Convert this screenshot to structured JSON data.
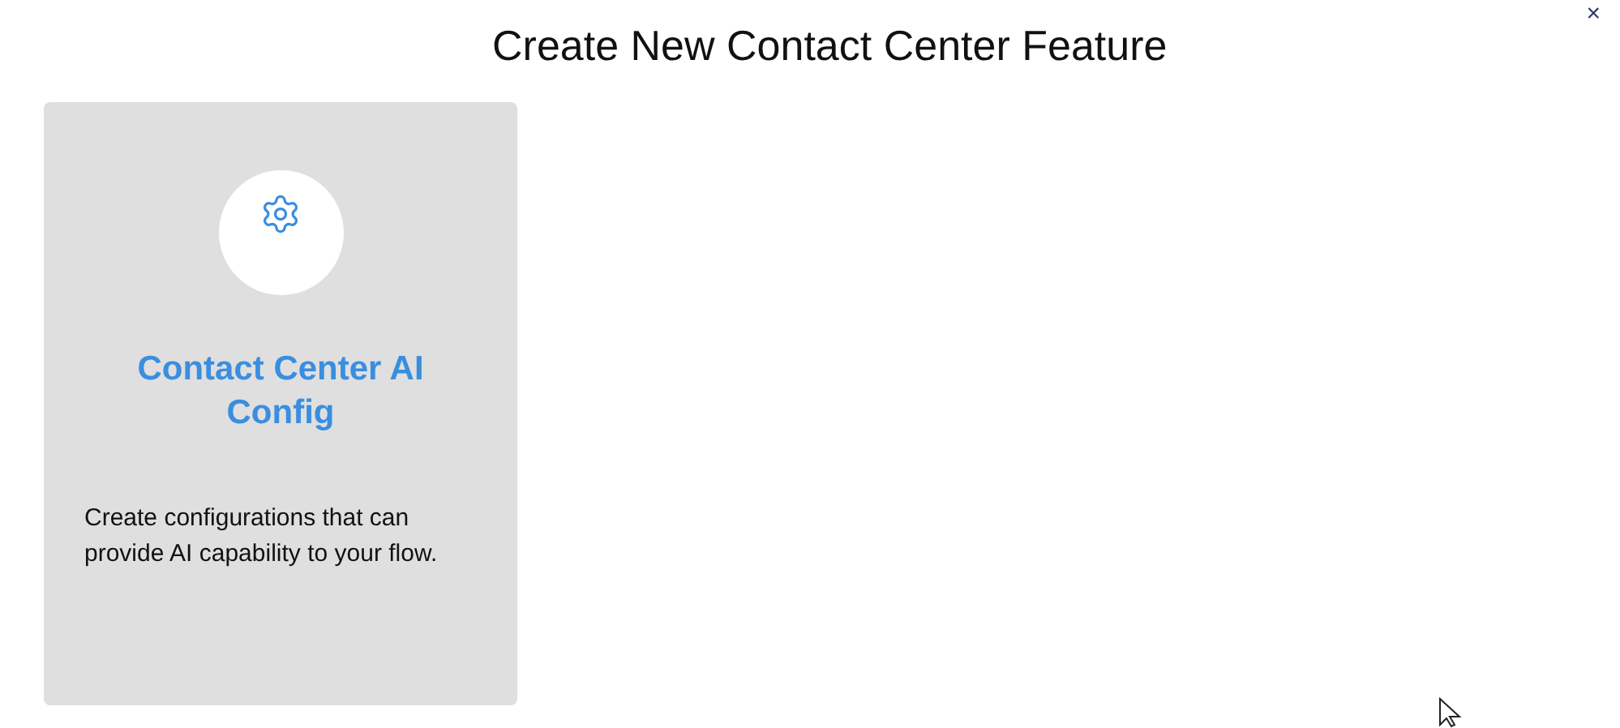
{
  "dialog": {
    "title": "Create New Contact Center Feature",
    "close": "×"
  },
  "features": [
    {
      "title": "Contact Center AI Config",
      "description": "Create configurations that can provide AI capability to your flow."
    }
  ]
}
